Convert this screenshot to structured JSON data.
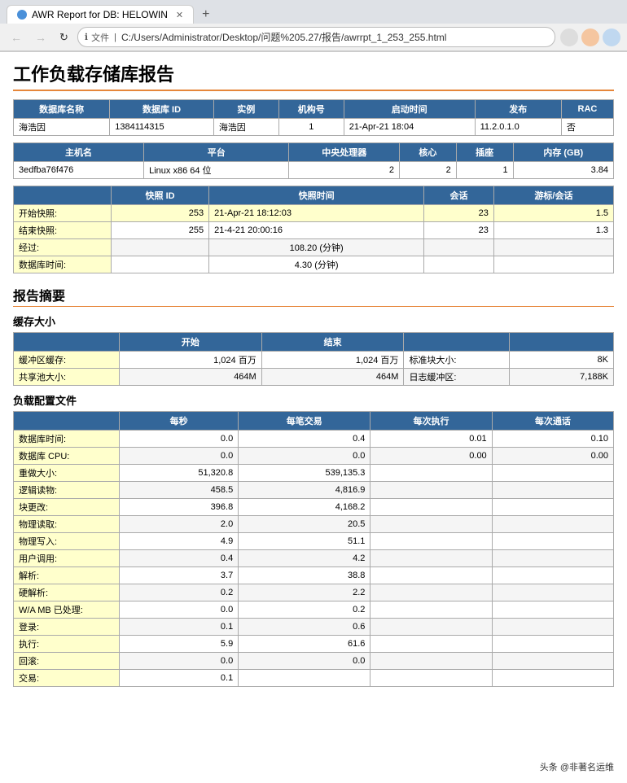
{
  "browser": {
    "tab_title": "AWR Report for DB: HELOWIN",
    "url": "C:/Users/Administrator/Desktop/问题%205.27/报告/awrrpt_1_253_255.html",
    "url_prefix": "文件",
    "new_tab_icon": "+"
  },
  "page": {
    "main_title": "工作负载存储库报告",
    "report_summary_title": "报告摘要",
    "cache_size_title": "缓存大小",
    "load_config_title": "负载配置文件"
  },
  "db_info": {
    "headers": [
      "数据库名称",
      "数据库 ID",
      "实例",
      "机构号",
      "启动时间",
      "发布",
      "RAC"
    ],
    "row": [
      "海浩因",
      "1384114315",
      "海浩因",
      "1",
      "21-Apr-21 18:04",
      "11.2.0.1.0",
      "否"
    ]
  },
  "host_info": {
    "headers": [
      "主机名",
      "平台",
      "中央处理器",
      "核心",
      "插座",
      "内存 (GB)"
    ],
    "row": [
      "3edfba76f476",
      "Linux x86 64 位",
      "2",
      "2",
      "1",
      "3.84"
    ]
  },
  "snapshot_info": {
    "headers": [
      "快照 ID",
      "快照时间",
      "会话",
      "游标/会话"
    ],
    "rows": [
      {
        "label": "开始快照:",
        "snap_id": "253",
        "snap_time": "21-Apr-21 18:12:03",
        "sessions": "23",
        "cursors": "1.5"
      },
      {
        "label": "结束快照:",
        "snap_id": "255",
        "snap_time": "21-4-21 20:00:16",
        "sessions": "23",
        "cursors": "1.3"
      },
      {
        "label": "经过:",
        "snap_id": "",
        "snap_time": "108.20 (分钟)",
        "sessions": "",
        "cursors": ""
      },
      {
        "label": "数据库时间:",
        "snap_id": "",
        "snap_time": "4.30 (分钟)",
        "sessions": "",
        "cursors": ""
      }
    ]
  },
  "cache_size": {
    "headers_left": [
      "开始",
      "结束"
    ],
    "headers_right": [
      "",
      ""
    ],
    "rows": [
      {
        "label": "缓冲区缓存:",
        "start": "1,024 百万",
        "end": "1,024 百万",
        "label2": "标准块大小:",
        "val2": "8K"
      },
      {
        "label": "共享池大小:",
        "start": "464M",
        "end": "464M",
        "label2": "日志缓冲区:",
        "val2": "7,188K"
      }
    ]
  },
  "load_profile": {
    "headers": [
      "每秒",
      "每笔交易",
      "每次执行",
      "每次通话"
    ],
    "rows": [
      {
        "label": "数据库时间:",
        "per_sec": "0.0",
        "per_txn": "0.4",
        "per_exec": "0.01",
        "per_call": "0.10",
        "highlight": true
      },
      {
        "label": "数据库 CPU:",
        "per_sec": "0.0",
        "per_txn": "0.0",
        "per_exec": "0.00",
        "per_call": "0.00",
        "highlight": false
      },
      {
        "label": "重做大小:",
        "per_sec": "51,320.8",
        "per_txn": "539,135.3",
        "per_exec": "",
        "per_call": "",
        "highlight": true
      },
      {
        "label": "逻辑读物:",
        "per_sec": "458.5",
        "per_txn": "4,816.9",
        "per_exec": "",
        "per_call": "",
        "highlight": false
      },
      {
        "label": "块更改:",
        "per_sec": "396.8",
        "per_txn": "4,168.2",
        "per_exec": "",
        "per_call": "",
        "highlight": true
      },
      {
        "label": "物理读取:",
        "per_sec": "2.0",
        "per_txn": "20.5",
        "per_exec": "",
        "per_call": "",
        "highlight": false
      },
      {
        "label": "物理写入:",
        "per_sec": "4.9",
        "per_txn": "51.1",
        "per_exec": "",
        "per_call": "",
        "highlight": true
      },
      {
        "label": "用户调用:",
        "per_sec": "0.4",
        "per_txn": "4.2",
        "per_exec": "",
        "per_call": "",
        "highlight": false
      },
      {
        "label": "解析:",
        "per_sec": "3.7",
        "per_txn": "38.8",
        "per_exec": "",
        "per_call": "",
        "highlight": true
      },
      {
        "label": "硬解析:",
        "per_sec": "0.2",
        "per_txn": "2.2",
        "per_exec": "",
        "per_call": "",
        "highlight": false
      },
      {
        "label": "W/A MB 已处理:",
        "per_sec": "0.0",
        "per_txn": "0.2",
        "per_exec": "",
        "per_call": "",
        "highlight": true
      },
      {
        "label": "登录:",
        "per_sec": "0.1",
        "per_txn": "0.6",
        "per_exec": "",
        "per_call": "",
        "highlight": false
      },
      {
        "label": "执行:",
        "per_sec": "5.9",
        "per_txn": "61.6",
        "per_exec": "",
        "per_call": "",
        "highlight": true
      },
      {
        "label": "回滚:",
        "per_sec": "0.0",
        "per_txn": "0.0",
        "per_exec": "",
        "per_call": "",
        "highlight": false
      },
      {
        "label": "交易:",
        "per_sec": "0.1",
        "per_txn": "",
        "per_exec": "",
        "per_call": "",
        "highlight": true
      }
    ]
  },
  "watermark": "头条 @非著名运维"
}
